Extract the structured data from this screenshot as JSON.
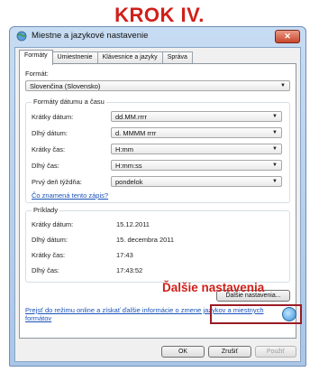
{
  "step_title": "KROK IV.",
  "window": {
    "title": "Miestne a jazykové nastavenie",
    "close_icon": "close-icon"
  },
  "tabs": [
    "Formáty",
    "Umiestnenie",
    "Klávesnice a jazyky",
    "Správa"
  ],
  "format": {
    "label": "Formát:",
    "value": "Slovenčina (Slovensko)"
  },
  "date_group": {
    "title": "Formáty dátumu a času",
    "rows": [
      {
        "label": "Krátky dátum:",
        "value": "dd.MM.rrrr"
      },
      {
        "label": "Dlhý dátum:",
        "value": "d. MMMM rrrr"
      },
      {
        "label": "Krátky čas:",
        "value": "H:mm"
      },
      {
        "label": "Dlhý čas:",
        "value": "H:mm:ss"
      },
      {
        "label": "Prvý deň týždňa:",
        "value": "pondelok"
      }
    ],
    "link": "Čo znamená tento zápis?"
  },
  "examples": {
    "title": "Príklady",
    "rows": [
      {
        "label": "Krátky dátum:",
        "value": "15.12.2011"
      },
      {
        "label": "Dlhý dátum:",
        "value": "15. decembra 2011"
      },
      {
        "label": "Krátky čas:",
        "value": "17:43"
      },
      {
        "label": "Dlhý čas:",
        "value": "17:43:52"
      }
    ]
  },
  "more_settings_button": "Ďalšie nastavenia...",
  "callout": "Ďalšie nastavenia",
  "online_link": "Prejsť do režimu online a získať ďalšie informácie o zmene jazykov a miestnych formátov",
  "buttons": {
    "ok": "OK",
    "cancel": "Zrušiť",
    "apply": "Použiť"
  },
  "colors": {
    "accent_red": "#d0201a",
    "link_blue": "#1a52b8"
  }
}
